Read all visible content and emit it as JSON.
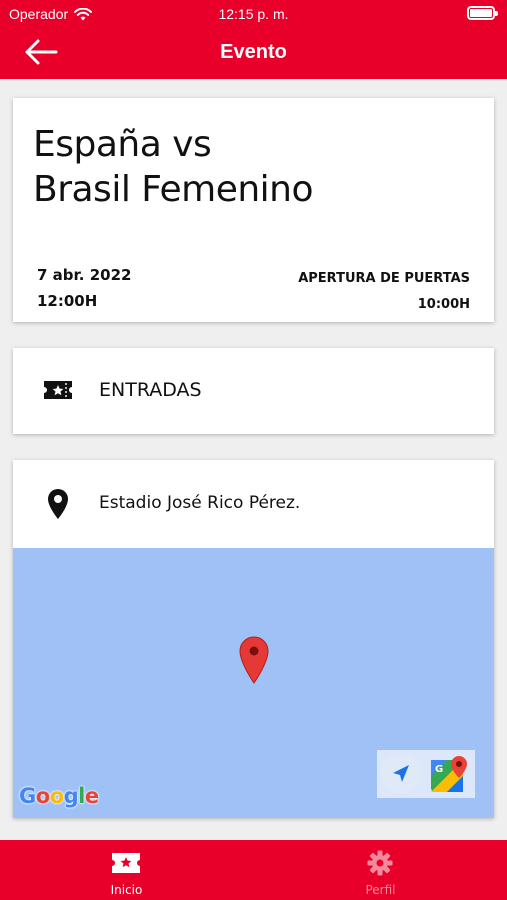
{
  "status_bar": {
    "carrier": "Operador",
    "time": "12:15 p. m."
  },
  "header": {
    "title": "Evento",
    "back_icon": "arrow-left-icon"
  },
  "event": {
    "title_line1": "España vs",
    "title_line2": "Brasil Femenino",
    "date": "7 abr. 2022",
    "time": "12:00H",
    "doors_label": "APERTURA DE PUERTAS",
    "doors_time": "10:00H"
  },
  "tickets": {
    "label": "ENTRADAS",
    "icon": "ticket-icon"
  },
  "location": {
    "venue": "Estadio José Rico Pérez.",
    "icon": "location-pin-icon",
    "map": {
      "logo": "Google",
      "background_color": "#9fc1f5"
    }
  },
  "tabbar": {
    "items": [
      {
        "label": "Inicio",
        "icon": "ticket-icon",
        "active": true
      },
      {
        "label": "Perfil",
        "icon": "gear-icon",
        "active": false
      }
    ]
  },
  "colors": {
    "brand": "#e8002a",
    "inactive_tab": "#f28a9c"
  }
}
